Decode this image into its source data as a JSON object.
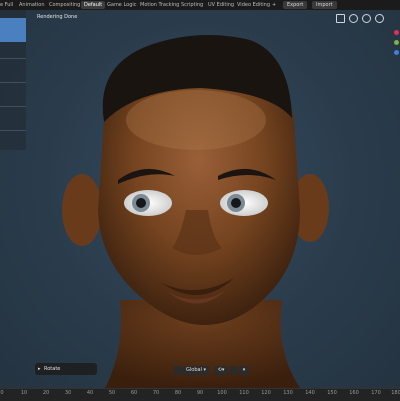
{
  "tabs": [
    {
      "label": "e Full"
    },
    {
      "label": "Animation"
    },
    {
      "label": "Compositing"
    },
    {
      "label": "Default"
    },
    {
      "label": "Game Logic"
    },
    {
      "label": "Motion Tracking"
    },
    {
      "label": "Scripting"
    },
    {
      "label": "UV Editing"
    },
    {
      "label": "Video Editing"
    },
    {
      "label": "+"
    }
  ],
  "active_tab": "Default",
  "buttons": {
    "export": "Export",
    "import": "Import"
  },
  "viewport": {
    "status_text": "Rendering Done"
  },
  "operator_panel": {
    "label": "Rotate"
  },
  "transform_orientation": "Global",
  "timeline_ticks": [
    "0",
    "10",
    "20",
    "30",
    "40",
    "50",
    "60",
    "70",
    "80",
    "90",
    "100",
    "110",
    "120",
    "130",
    "140",
    "150",
    "160",
    "170",
    "180"
  ],
  "colors": {
    "accent": "#4a7fc0",
    "background": "#2a3a48",
    "skin": "#7a4a2a"
  },
  "gizmo_colors": [
    "#e0305a",
    "#7cb342",
    "#3f7fe0"
  ]
}
